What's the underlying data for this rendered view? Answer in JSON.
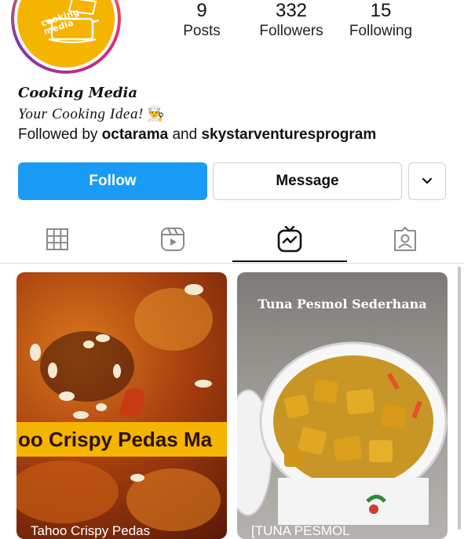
{
  "profile": {
    "name": "Cooking Media",
    "tagline": "Your Cooking Idea!",
    "tagline_emoji": "👨‍🍳",
    "followed_by_prefix": "Followed by",
    "followed_by_1": "octarama",
    "followed_by_and": "and",
    "followed_by_2": "skystarventuresprogram",
    "logo_text": "cooking media"
  },
  "stats": [
    {
      "value": "9",
      "label": "Posts"
    },
    {
      "value": "332",
      "label": "Followers"
    },
    {
      "value": "15",
      "label": "Following"
    }
  ],
  "actions": {
    "follow": "Follow",
    "message": "Message"
  },
  "tabs": [
    {
      "icon": "grid-icon"
    },
    {
      "icon": "reels-icon"
    },
    {
      "icon": "igtv-icon",
      "selected": true
    },
    {
      "icon": "tagged-icon"
    }
  ],
  "posts": [
    {
      "banner": "oo Crispy Pedas Ma",
      "caption": "Tahoo Crispy Pedas"
    },
    {
      "title": "Tuna Pesmol Sederhana",
      "caption": "[TUNA PESMOL"
    }
  ],
  "colors": {
    "follow": "#1a9bf7",
    "avatar": "#f5b400",
    "banner": "#f5b400"
  }
}
